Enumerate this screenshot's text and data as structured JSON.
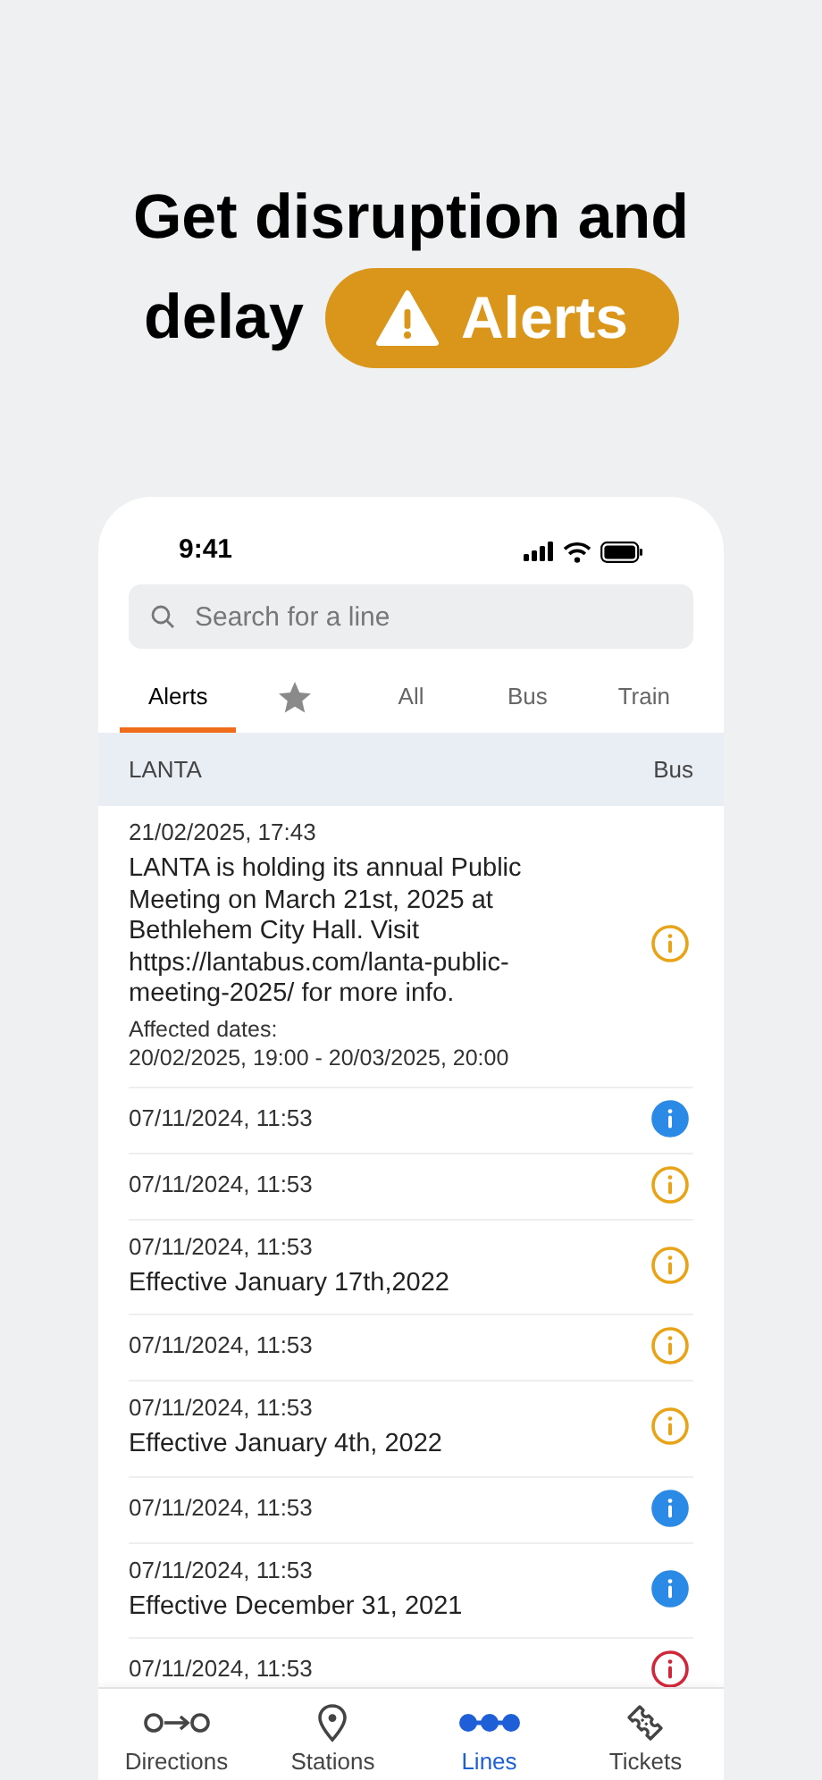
{
  "headline": {
    "line1": "Get disruption and",
    "line2": "delay",
    "badge": "Alerts"
  },
  "status_bar": {
    "time": "9:41"
  },
  "search": {
    "placeholder": "Search for a line"
  },
  "tabs": [
    {
      "kind": "text",
      "label": "Alerts",
      "selected": true
    },
    {
      "kind": "favorites",
      "selected": false
    },
    {
      "kind": "text",
      "label": "All",
      "selected": false
    },
    {
      "kind": "text",
      "label": "Bus",
      "selected": false
    },
    {
      "kind": "text",
      "label": "Train",
      "selected": false
    }
  ],
  "section": {
    "agency": "LANTA",
    "mode": "Bus"
  },
  "alerts": [
    {
      "date": "21/02/2025, 17:43",
      "message": "LANTA is holding its annual Public Meeting on March 21st, 2025 at Bethlehem City Hall. Visit https://lantabus.com/lanta-public-meeting-2025/ for more info.",
      "affected_label": "Affected dates:",
      "affected_range": "20/02/2025, 19:00 - 20/03/2025, 20:00",
      "kind": "warning"
    },
    {
      "date": "07/11/2024, 11:53",
      "kind": "info"
    },
    {
      "date": "07/11/2024, 11:53",
      "kind": "warning"
    },
    {
      "date": "07/11/2024, 11:53",
      "message": "Effective January 17th,2022",
      "kind": "warning"
    },
    {
      "date": "07/11/2024, 11:53",
      "kind": "warning"
    },
    {
      "date": "07/11/2024, 11:53",
      "message": "Effective January 4th, 2022",
      "kind": "warning"
    },
    {
      "date": "07/11/2024, 11:53",
      "kind": "info"
    },
    {
      "date": "07/11/2024, 11:53",
      "message": "Effective December 31, 2021",
      "kind": "info"
    },
    {
      "date": "07/11/2024, 11:53",
      "kind": "severe"
    }
  ],
  "bottom_nav": [
    {
      "kind": "directions",
      "label": "Directions",
      "selected": false
    },
    {
      "kind": "stations",
      "label": "Stations",
      "selected": false
    },
    {
      "kind": "lines",
      "label": "Lines",
      "selected": true
    },
    {
      "kind": "tickets",
      "label": "Tickets",
      "selected": false
    }
  ]
}
